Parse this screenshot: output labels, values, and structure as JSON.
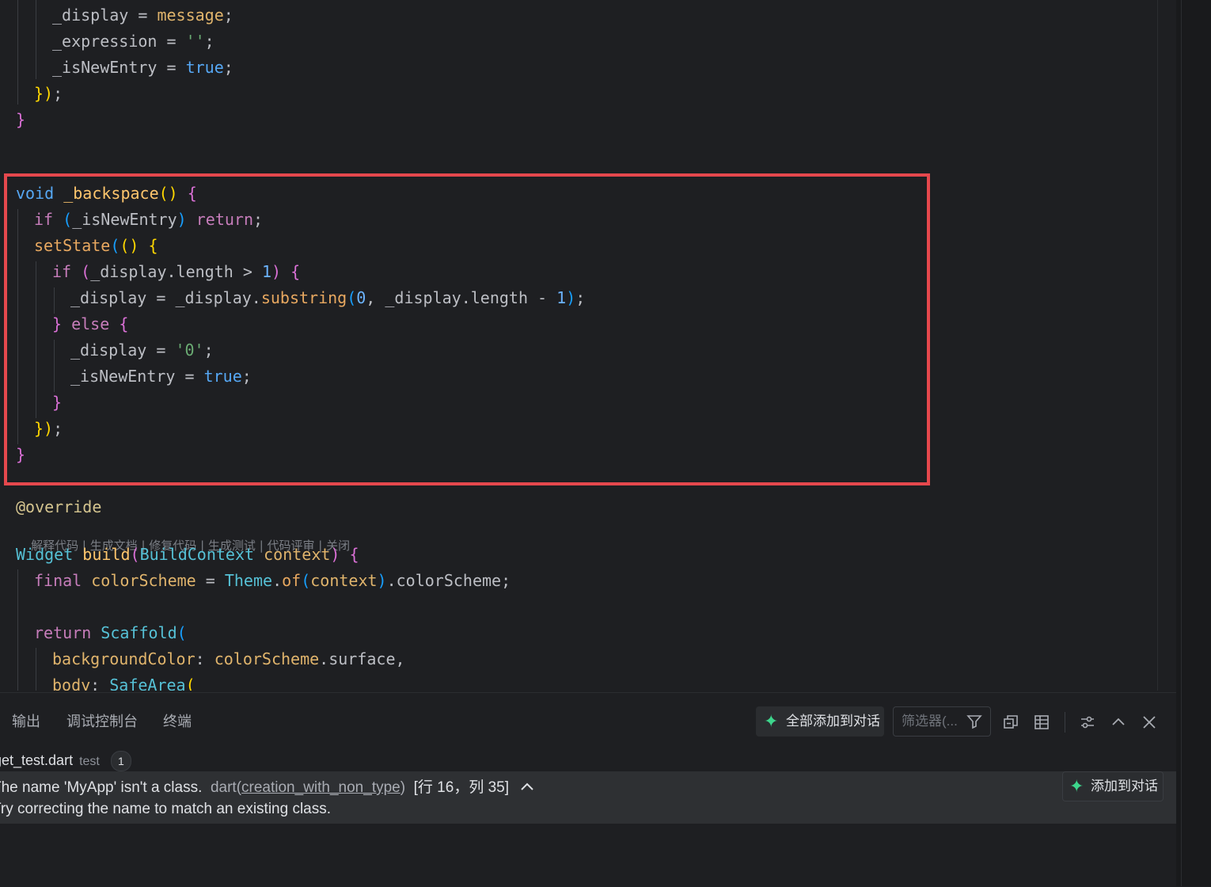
{
  "code": {
    "lines": {
      "l1": [
        "_display",
        " = ",
        "message",
        ";"
      ],
      "l2": [
        "_expression",
        " = ",
        "''",
        ";"
      ],
      "l3": [
        "_isNewEntry",
        " = ",
        "true",
        ";"
      ],
      "l4": [
        "})",
        ";"
      ],
      "l5": [
        "}"
      ],
      "bs1": [
        "void",
        " ",
        "_backspace",
        "()",
        " ",
        "{"
      ],
      "bs2": [
        "if",
        " ",
        "(",
        "_isNewEntry",
        ")",
        " ",
        "return",
        ";"
      ],
      "bs3": [
        "setState",
        "(",
        "()",
        " ",
        "{"
      ],
      "bs4": [
        "if",
        " ",
        "(",
        "_display.length",
        " > ",
        "1",
        ")",
        " ",
        "{"
      ],
      "bs5": [
        "_display",
        " = ",
        "_display.",
        "substring",
        "(",
        "0",
        ", ",
        "_display.length",
        " - ",
        "1",
        ")",
        ";"
      ],
      "bs6": [
        "}",
        " ",
        "else",
        " ",
        "{"
      ],
      "bs7": [
        "_display",
        " = ",
        "'0'",
        ";"
      ],
      "bs8": [
        "_isNewEntry",
        " = ",
        "true",
        ";"
      ],
      "bs9": [
        "}"
      ],
      "bs10": [
        "})",
        ";"
      ],
      "bs11": [
        "}"
      ],
      "ov": [
        "@override"
      ],
      "b1": [
        "Widget",
        " ",
        "build",
        "(",
        "BuildContext",
        " ",
        "context",
        ")",
        " ",
        "{"
      ],
      "b2": [
        "final",
        " ",
        "colorScheme",
        " = ",
        "Theme",
        ".",
        "of",
        "(",
        "context",
        ")",
        ".colorScheme;"
      ],
      "b3": [
        "return",
        " ",
        "Scaffold",
        "("
      ],
      "b4": [
        "backgroundColor",
        ": ",
        "colorScheme",
        ".surface,"
      ],
      "b5": [
        "body",
        ": ",
        "SafeArea",
        "("
      ]
    },
    "codelens": [
      "解释代码",
      "生成文档",
      "修复代码",
      "生成测试",
      "代码评审",
      "关闭"
    ],
    "codelens_sep": " | "
  },
  "panel": {
    "tabs": [
      "输出",
      "调试控制台",
      "终端"
    ],
    "add_all_label": "全部添加到对话",
    "filter_placeholder": "筛选器(...",
    "file": {
      "name": "get_test.dart",
      "folder": "test",
      "count": "1"
    },
    "problem": {
      "message": "The name 'MyApp' isn't a class.",
      "source": "dart",
      "code": "creation_with_non_type",
      "position": "[行 16，列 35]",
      "hint": "Try correcting the name to match an existing class.",
      "add_chat_label": "添加到对话"
    }
  },
  "colors": {
    "highlight_border": "#e5484d",
    "accent_star": "#3dd68c"
  }
}
